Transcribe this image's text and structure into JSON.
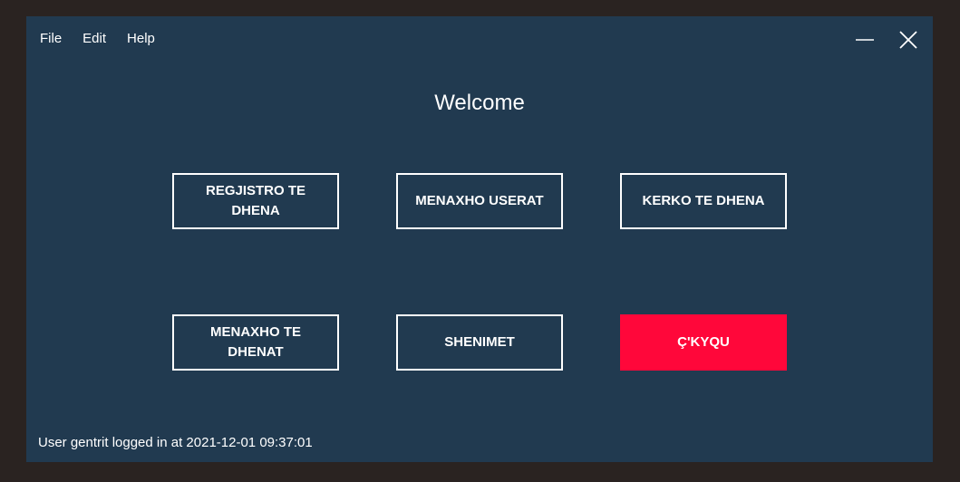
{
  "menu": {
    "file": "File",
    "edit": "Edit",
    "help": "Help"
  },
  "window_controls": {
    "minimize_icon": "minimize-icon",
    "close_icon": "close-icon"
  },
  "title": "Welcome",
  "buttons": {
    "register": "REGJISTRO TE DHENA",
    "manage_users": "MENAXHO USERAT",
    "search": "KERKO TE DHENA",
    "manage_data": "MENAXHO TE DHENAT",
    "notes": "SHENIMET",
    "logout": "Ç'KYQU"
  },
  "status": "User gentrit logged in at 2021-12-01 09:37:01",
  "colors": {
    "background": "#213a50",
    "danger": "#ff073a",
    "border": "#ffffff"
  }
}
